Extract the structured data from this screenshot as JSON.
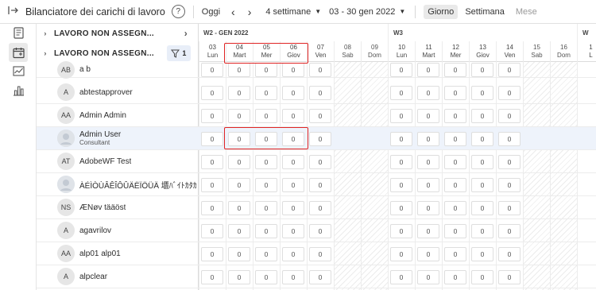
{
  "toolbar": {
    "title": "Bilanciatore dei carichi di lavoro",
    "help": "?",
    "today": "Oggi",
    "weeks": "4 settimane",
    "range": "03 - 30 gen 2022",
    "views": [
      "Giorno",
      "Settimana",
      "Mese"
    ],
    "active_view": "Giorno"
  },
  "unassigned": [
    {
      "label": "LAVORO NON ASSEGN..."
    },
    {
      "label": "LAVORO NON ASSEGN...",
      "filter_count": "1"
    }
  ],
  "weeks": [
    {
      "label": "W2 - GEN 2022"
    },
    {
      "label": "W3"
    },
    {
      "label": "W"
    }
  ],
  "days": [
    {
      "num": "03",
      "name": "Lun",
      "weekend": false
    },
    {
      "num": "04",
      "name": "Mart",
      "weekend": false
    },
    {
      "num": "05",
      "name": "Mer",
      "weekend": false
    },
    {
      "num": "06",
      "name": "Giov",
      "weekend": false
    },
    {
      "num": "07",
      "name": "Ven",
      "weekend": false
    },
    {
      "num": "08",
      "name": "Sab",
      "weekend": true
    },
    {
      "num": "09",
      "name": "Dom",
      "weekend": true
    },
    {
      "num": "10",
      "name": "Lun",
      "weekend": false
    },
    {
      "num": "11",
      "name": "Mart",
      "weekend": false
    },
    {
      "num": "12",
      "name": "Mer",
      "weekend": false
    },
    {
      "num": "13",
      "name": "Giov",
      "weekend": false
    },
    {
      "num": "14",
      "name": "Ven",
      "weekend": false
    },
    {
      "num": "15",
      "name": "Sab",
      "weekend": true
    },
    {
      "num": "16",
      "name": "Dom",
      "weekend": true
    },
    {
      "num": "1",
      "name": "L",
      "weekend": false
    }
  ],
  "users": [
    {
      "initials": "AB",
      "name": "a b",
      "sub": "",
      "highlight": false
    },
    {
      "initials": "A",
      "name": "abtestapprover",
      "sub": "",
      "highlight": false
    },
    {
      "initials": "AA",
      "name": "Admin Admin",
      "sub": "",
      "highlight": false
    },
    {
      "initials": "",
      "name": "Admin User",
      "sub": "Consultant",
      "highlight": true
    },
    {
      "initials": "AT",
      "name": "AdobeWF Test",
      "sub": "",
      "highlight": false
    },
    {
      "initials": "",
      "name": "ÀÉÌÒÙÂÊÎÔÛÄËÏÖÜÄ 㙺ﾊﾞｲﾄｶﾀｶ",
      "sub": "",
      "highlight": false
    },
    {
      "initials": "NS",
      "name": "ÆNøv tääöst",
      "sub": "",
      "highlight": false
    },
    {
      "initials": "A",
      "name": "agavrilov",
      "sub": "",
      "highlight": false
    },
    {
      "initials": "AA",
      "name": "alp01 alp01",
      "sub": "",
      "highlight": false
    },
    {
      "initials": "A",
      "name": "alpclear",
      "sub": "",
      "highlight": false
    }
  ],
  "cell_value": "0",
  "colors": {
    "highlight_box": "#e02424",
    "active_bg": "#e9e9e9",
    "row_highlight": "#eef3fb"
  }
}
